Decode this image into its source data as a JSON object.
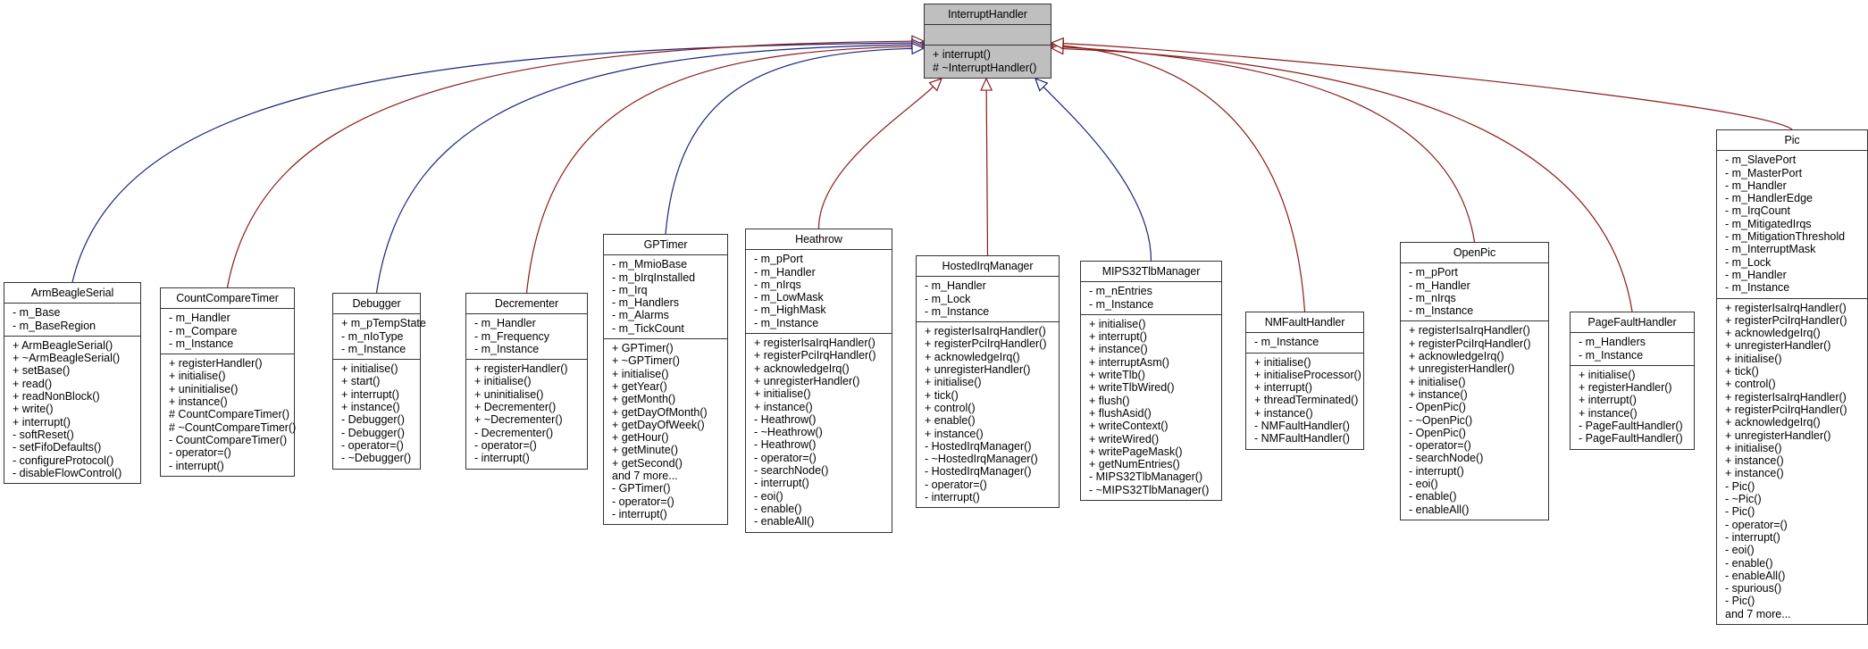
{
  "diagram": {
    "type": "class-inheritance",
    "colors": {
      "public_inheritance": "#1a237e",
      "protected_inheritance": "#8b1a1a",
      "base_fill": "#bfbfbf",
      "box_border": "#333333"
    },
    "base": {
      "name": "InterruptHandler",
      "attributes": [],
      "operations": [
        "+ interrupt()",
        "# ~InterruptHandler()"
      ]
    },
    "classes": [
      {
        "name": "ArmBeagleSerial",
        "edge": "public",
        "attributes": [
          "- m_Base",
          "- m_BaseRegion"
        ],
        "operations": [
          "+ ArmBeagleSerial()",
          "+ ~ArmBeagleSerial()",
          "+ setBase()",
          "+ read()",
          "+ readNonBlock()",
          "+ write()",
          "+ interrupt()",
          "- softReset()",
          "- setFifoDefaults()",
          "- configureProtocol()",
          "- disableFlowControl()"
        ]
      },
      {
        "name": "CountCompareTimer",
        "edge": "protected",
        "attributes": [
          "- m_Handler",
          "- m_Compare",
          "- m_Instance"
        ],
        "operations": [
          "+ registerHandler()",
          "+ initialise()",
          "+ uninitialise()",
          "+ instance()",
          "# CountCompareTimer()",
          "# ~CountCompareTimer()",
          "- CountCompareTimer()",
          "- operator=()",
          "- interrupt()"
        ]
      },
      {
        "name": "Debugger",
        "edge": "public",
        "attributes": [
          "+ m_pTempState",
          "- m_nIoType",
          "- m_Instance"
        ],
        "operations": [
          "+ initialise()",
          "+ start()",
          "+ interrupt()",
          "+ instance()",
          "- Debugger()",
          "- Debugger()",
          "- operator=()",
          "- ~Debugger()"
        ]
      },
      {
        "name": "Decrementer",
        "edge": "protected",
        "attributes": [
          "- m_Handler",
          "- m_Frequency",
          "- m_Instance"
        ],
        "operations": [
          "+ registerHandler()",
          "+ initialise()",
          "+ uninitialise()",
          "+ Decrementer()",
          "+ ~Decrementer()",
          "- Decrementer()",
          "- operator=()",
          "- interrupt()"
        ]
      },
      {
        "name": "GPTimer",
        "edge": "public",
        "attributes": [
          "- m_MmioBase",
          "- m_bIrqInstalled",
          "- m_Irq",
          "- m_Handlers",
          "- m_Alarms",
          "- m_TickCount"
        ],
        "operations": [
          "+ GPTimer()",
          "+ ~GPTimer()",
          "+ initialise()",
          "+ getYear()",
          "+ getMonth()",
          "+ getDayOfMonth()",
          "+ getDayOfWeek()",
          "+ getHour()",
          "+ getMinute()",
          "+ getSecond()",
          "and 7 more...",
          "- GPTimer()",
          "- operator=()",
          "- interrupt()"
        ]
      },
      {
        "name": "Heathrow",
        "edge": "protected",
        "attributes": [
          "- m_pPort",
          "- m_Handler",
          "- m_nIrqs",
          "- m_LowMask",
          "- m_HighMask",
          "- m_Instance"
        ],
        "operations": [
          "+ registerIsaIrqHandler()",
          "+ registerPciIrqHandler()",
          "+ acknowledgeIrq()",
          "+ unregisterHandler()",
          "+ initialise()",
          "+ instance()",
          "- Heathrow()",
          "- ~Heathrow()",
          "- Heathrow()",
          "- operator=()",
          "- searchNode()",
          "- interrupt()",
          "- eoi()",
          "- enable()",
          "- enableAll()"
        ]
      },
      {
        "name": "HostedIrqManager",
        "edge": "protected",
        "attributes": [
          "- m_Handler",
          "- m_Lock",
          "- m_Instance"
        ],
        "operations": [
          "+ registerIsaIrqHandler()",
          "+ registerPciIrqHandler()",
          "+ acknowledgeIrq()",
          "+ unregisterHandler()",
          "+ initialise()",
          "+ tick()",
          "+ control()",
          "+ enable()",
          "+ instance()",
          "- HostedIrqManager()",
          "- ~HostedIrqManager()",
          "- HostedIrqManager()",
          "- operator=()",
          "- interrupt()"
        ]
      },
      {
        "name": "MIPS32TlbManager",
        "edge": "public",
        "attributes": [
          "- m_nEntries",
          "- m_Instance"
        ],
        "operations": [
          "+ initialise()",
          "+ interrupt()",
          "+ instance()",
          "+ interruptAsm()",
          "+ writeTlb()",
          "+ writeTlbWired()",
          "+ flush()",
          "+ flushAsid()",
          "+ writeContext()",
          "+ writeWired()",
          "+ writePageMask()",
          "+ getNumEntries()",
          "- MIPS32TlbManager()",
          "- ~MIPS32TlbManager()"
        ]
      },
      {
        "name": "NMFaultHandler",
        "edge": "protected",
        "attributes": [
          "- m_Instance"
        ],
        "operations": [
          "+ initialise()",
          "+ initialiseProcessor()",
          "+ interrupt()",
          "+ threadTerminated()",
          "+ instance()",
          "- NMFaultHandler()",
          "- NMFaultHandler()"
        ]
      },
      {
        "name": "OpenPic",
        "edge": "protected",
        "attributes": [
          "- m_pPort",
          "- m_Handler",
          "- m_nIrqs",
          "- m_Instance"
        ],
        "operations": [
          "+ registerIsaIrqHandler()",
          "+ registerPciIrqHandler()",
          "+ acknowledgeIrq()",
          "+ unregisterHandler()",
          "+ initialise()",
          "+ instance()",
          "- OpenPic()",
          "- ~OpenPic()",
          "- OpenPic()",
          "- operator=()",
          "- searchNode()",
          "- interrupt()",
          "- eoi()",
          "- enable()",
          "- enableAll()"
        ]
      },
      {
        "name": "PageFaultHandler",
        "edge": "protected",
        "attributes": [
          "- m_Handlers",
          "- m_Instance"
        ],
        "operations": [
          "+ initialise()",
          "+ registerHandler()",
          "+ interrupt()",
          "+ instance()",
          "- PageFaultHandler()",
          "- PageFaultHandler()"
        ]
      },
      {
        "name": "Pic",
        "edge": "protected",
        "attributes": [
          "- m_SlavePort",
          "- m_MasterPort",
          "- m_Handler",
          "- m_HandlerEdge",
          "- m_IrqCount",
          "- m_MitigatedIrqs",
          "- m_MitigationThreshold",
          "- m_InterruptMask",
          "- m_Lock",
          "- m_Handler",
          "- m_Instance"
        ],
        "operations": [
          "+ registerIsaIrqHandler()",
          "+ registerPciIrqHandler()",
          "+ acknowledgeIrq()",
          "+ unregisterHandler()",
          "+ initialise()",
          "+ tick()",
          "+ control()",
          "+ registerIsaIrqHandler()",
          "+ registerPciIrqHandler()",
          "+ acknowledgeIrq()",
          "+ unregisterHandler()",
          "+ initialise()",
          "+ instance()",
          "+ instance()",
          "- Pic()",
          "- ~Pic()",
          "- Pic()",
          "- operator=()",
          "- interrupt()",
          "- eoi()",
          "- enable()",
          "- enableAll()",
          "- spurious()",
          "- Pic()",
          "and 7 more..."
        ]
      }
    ]
  }
}
